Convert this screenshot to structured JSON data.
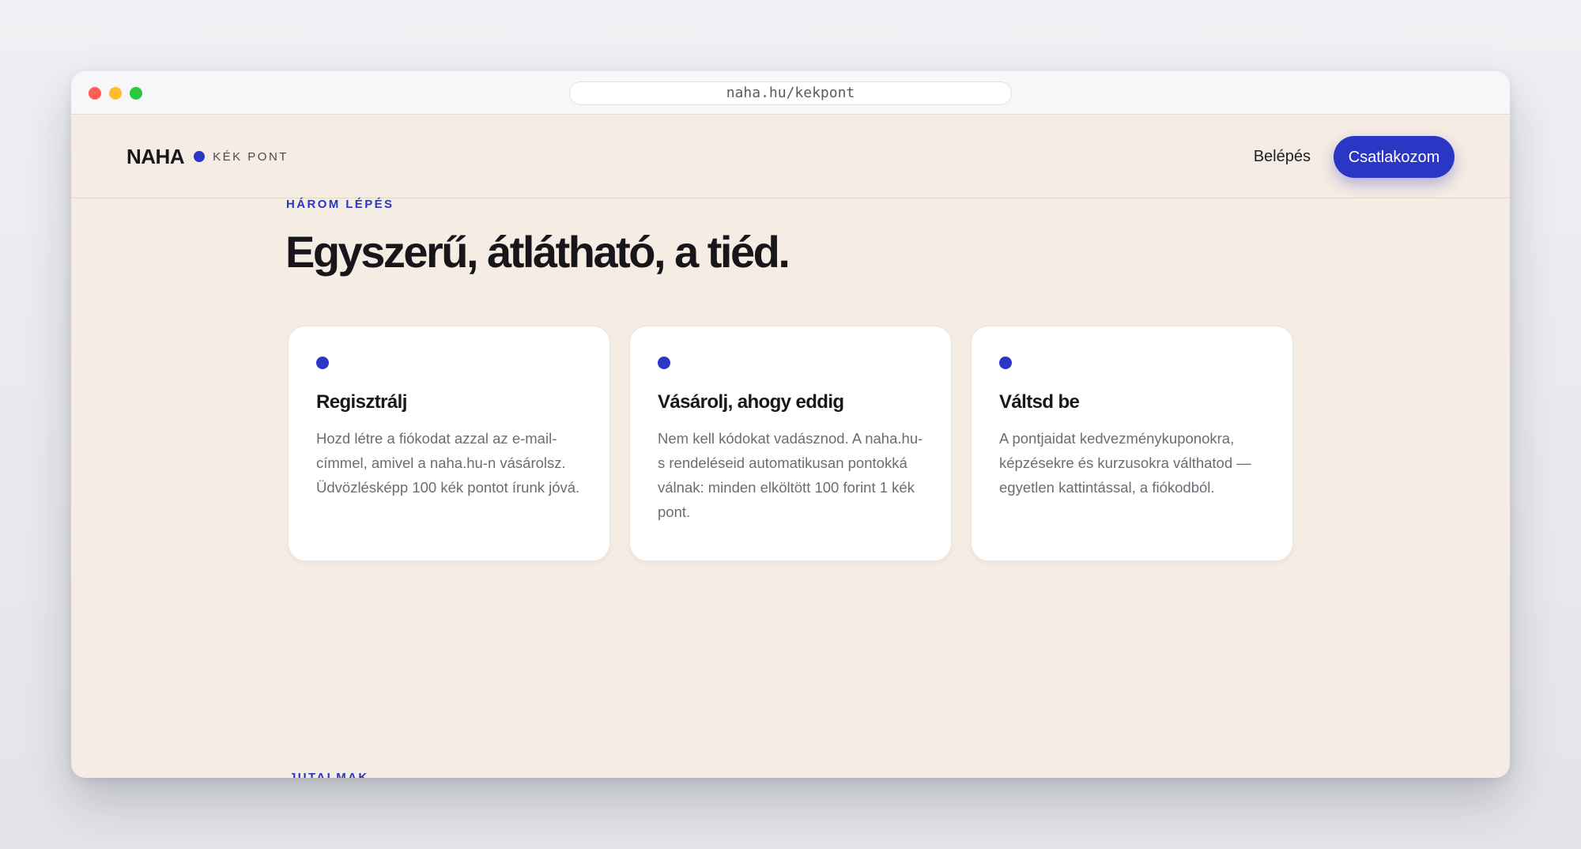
{
  "browser": {
    "url": "naha.hu/kekpont"
  },
  "header": {
    "logo_word": "NAHA",
    "logo_sub": "KÉK PONT",
    "login_label": "Belépés",
    "cta_label": "Csatlakozom"
  },
  "section": {
    "eyebrow": "HÁROM LÉPÉS",
    "headline": "Egyszerű, átlátható, a tiéd.",
    "cards": [
      {
        "title": "Regisztrálj",
        "body": "Hozd létre a fiókodat azzal az e-mail-címmel, amivel a naha.hu-n vásárolsz. Üdvözlésképp 100 kék pontot írunk jóvá."
      },
      {
        "title": "Vásárolj, ahogy eddig",
        "body": "Nem kell kódokat vadásznod. A naha.hu-s rendeléseid automatikusan pontokká válnak: minden elköltött 100 forint 1 kék pont."
      },
      {
        "title": "Váltsd be",
        "body": "A pontjaidat kedvezménykuponokra, képzésekre és kurzusokra válthatod — egyetlen kattintással, a fiókodból."
      }
    ]
  },
  "next_section": {
    "eyebrow": "JUTALMAK"
  },
  "colors": {
    "accent": "#2a36c4",
    "page_background": "#f5ece3",
    "text_dark": "#16161b",
    "text_muted": "#6c6c74"
  },
  "icons": {
    "logo_dot": "blue-dot-icon",
    "card_marker": "blue-dot-icon"
  }
}
